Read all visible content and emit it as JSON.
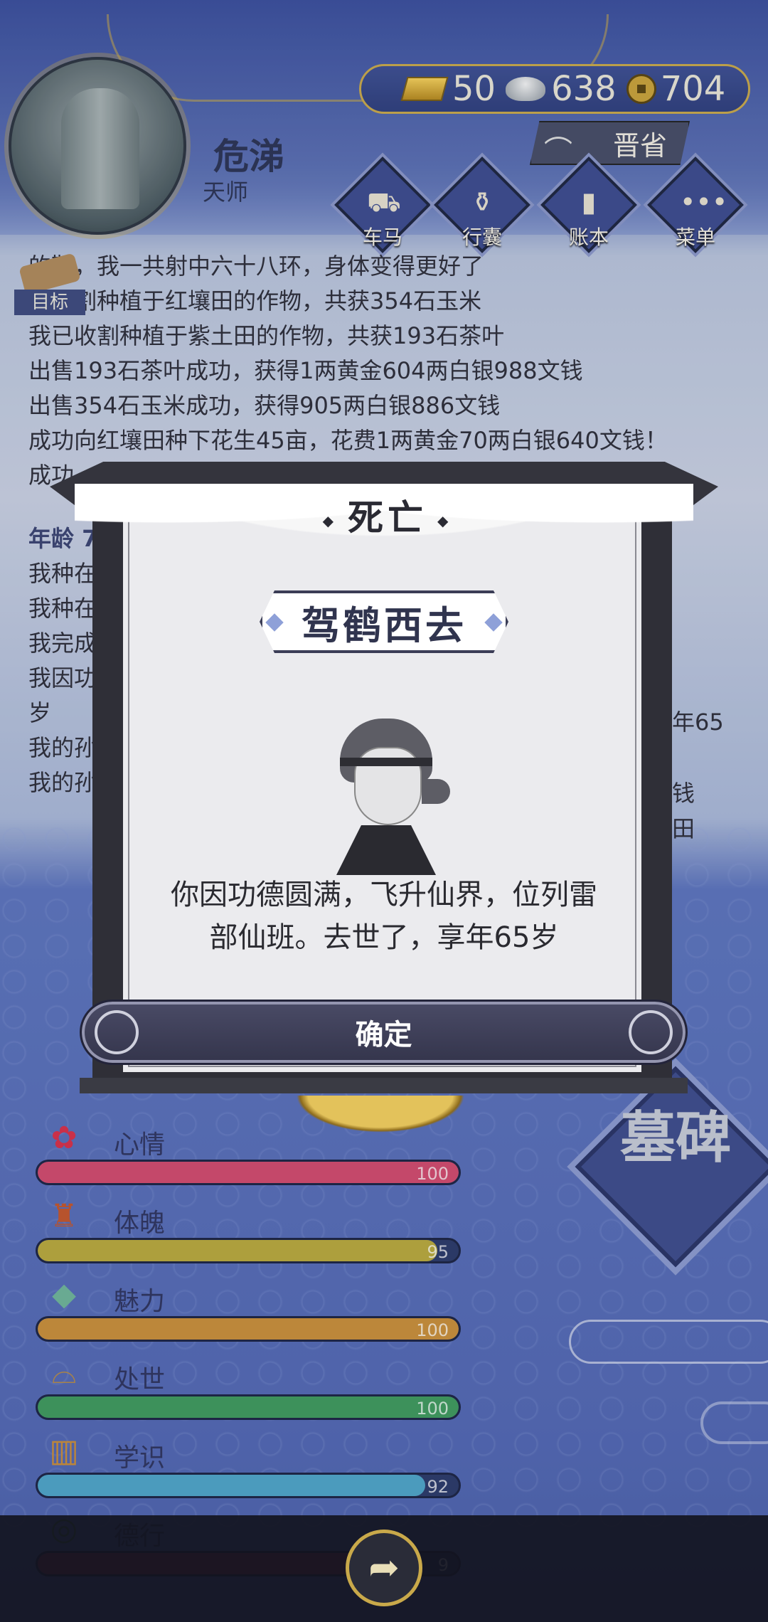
{
  "player": {
    "name": "危涕",
    "title": "天师"
  },
  "currency": {
    "gold": "50",
    "silver": "638",
    "copper": "704"
  },
  "province": "晋省",
  "nav": [
    {
      "label": "车马",
      "icon": "carriage-icon"
    },
    {
      "label": "行囊",
      "icon": "bag-icon"
    },
    {
      "label": "账本",
      "icon": "ledger-icon"
    },
    {
      "label": "菜单",
      "icon": "menu-dots-icon"
    }
  ],
  "goal_label": "目标",
  "log": {
    "lines": [
      "的靶，我一共射中六十八环，身体变得更好了",
      "已收割种植于红壤田的作物，共获354石玉米",
      "我已收割种植于紫土田的作物，共获193石茶叶",
      "出售193石茶叶成功，获得1两黄金604两白银988文钱",
      "出售354石玉米成功，获得905两白银886文钱",
      "成功向红壤田种下花生45亩，花费1两黄金70两白银640文钱！",
      "成功"
    ],
    "age_heading": "年龄 7",
    "lines2": [
      "我种在",
      "我种在",
      "我完成",
      "我因功",
      "岁",
      "我的孙",
      "我的孙"
    ],
    "right_fragments": [
      "年65",
      "钱",
      "田"
    ]
  },
  "modal": {
    "title": "死亡",
    "banner": "驾鹤西去",
    "description_line1": "你因功德圆满，飞升仙界，位列雷",
    "description_line2": "部仙班。去世了，享年65岁",
    "confirm_label": "确定"
  },
  "stats": [
    {
      "name": "心情",
      "value": "100",
      "percent": 100,
      "color": "#d24a6e",
      "icon": "flower-icon"
    },
    {
      "name": "体魄",
      "value": "95",
      "percent": 95,
      "color": "#b9a93d",
      "icon": "hydrant-icon"
    },
    {
      "name": "魅力",
      "value": "100",
      "percent": 100,
      "color": "#c98f3a",
      "icon": "jade-icon"
    },
    {
      "name": "处世",
      "value": "100",
      "percent": 100,
      "color": "#3f9a5e",
      "icon": "hat-icon"
    },
    {
      "name": "学识",
      "value": "92",
      "percent": 92,
      "color": "#4fa4c8",
      "icon": "brush-holder-icon"
    },
    {
      "name": "德行",
      "value": "9",
      "percent": 90,
      "color": "#8f2d52",
      "icon": "coin-icon"
    }
  ],
  "tomb_label": "墓碑",
  "share_icon": "share-icon"
}
